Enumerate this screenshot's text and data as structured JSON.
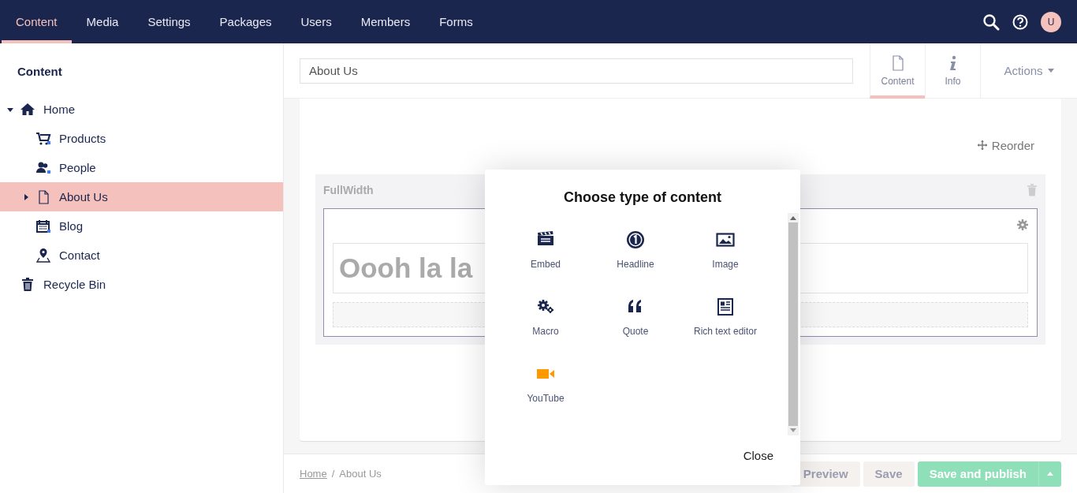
{
  "top_nav": {
    "sections": [
      {
        "label": "Content",
        "selected": true
      },
      {
        "label": "Media",
        "selected": false
      },
      {
        "label": "Settings",
        "selected": false
      },
      {
        "label": "Packages",
        "selected": false
      },
      {
        "label": "Users",
        "selected": false
      },
      {
        "label": "Members",
        "selected": false
      },
      {
        "label": "Forms",
        "selected": false
      }
    ],
    "avatar": "U"
  },
  "sidebar": {
    "title": "Content",
    "tree": [
      {
        "label": "Home",
        "selected": false,
        "expanded": true,
        "children": [
          {
            "label": "Products",
            "selected": false
          },
          {
            "label": "People",
            "selected": false
          },
          {
            "label": "About Us",
            "selected": true,
            "expanded": false,
            "has_children": true
          },
          {
            "label": "Blog",
            "selected": false
          },
          {
            "label": "Contact",
            "selected": false
          }
        ]
      },
      {
        "label": "Recycle Bin",
        "selected": false
      }
    ]
  },
  "editor": {
    "name": "About Us",
    "apps": [
      {
        "label": "Content",
        "selected": true
      },
      {
        "label": "Info",
        "selected": false
      }
    ],
    "actions": "Actions",
    "reorder": "Reorder",
    "section": {
      "title": "FullWidth",
      "headline": "Oooh la la"
    }
  },
  "footer": {
    "breadcrumbs": [
      {
        "label": "Home",
        "link": true
      },
      {
        "label": "About Us",
        "link": false
      }
    ],
    "separator": "/",
    "buttons": [
      "Preview",
      "Save",
      "Save and publish"
    ]
  },
  "dialog": {
    "title": "Choose type of content",
    "items": [
      {
        "label": "Embed"
      },
      {
        "label": "Headline"
      },
      {
        "label": "Image"
      },
      {
        "label": "Macro"
      },
      {
        "label": "Quote"
      },
      {
        "label": "Rich text editor"
      },
      {
        "label": "YouTube",
        "color": "#ff9900"
      }
    ],
    "close": "Close"
  }
}
